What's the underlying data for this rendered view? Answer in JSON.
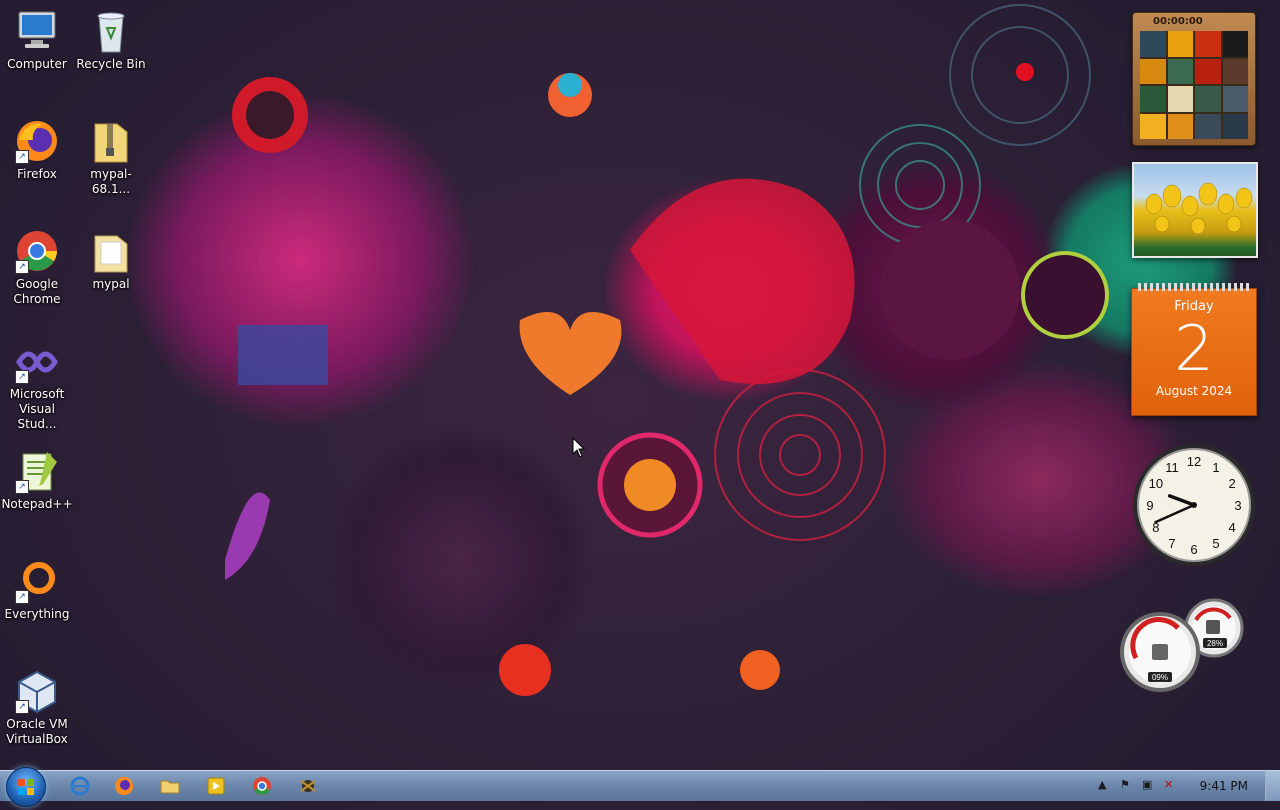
{
  "desktop": {
    "icons": [
      {
        "label": "Computer",
        "icon": "computer-icon"
      },
      {
        "label": "Recycle Bin",
        "icon": "recycle-bin-icon"
      },
      {
        "label": "Firefox",
        "icon": "firefox-icon"
      },
      {
        "label": "mypal-68.1...",
        "icon": "zip-folder-icon"
      },
      {
        "label": "Google Chrome",
        "icon": "chrome-icon"
      },
      {
        "label": "mypal",
        "icon": "folder-icon"
      },
      {
        "label": "Microsoft Visual Stud...",
        "icon": "visual-studio-icon"
      },
      {
        "label": "Notepad++",
        "icon": "notepadpp-icon"
      },
      {
        "label": "Everything",
        "icon": "everything-icon"
      },
      {
        "label": "Oracle VM VirtualBox",
        "icon": "virtualbox-icon"
      }
    ]
  },
  "gadgets": {
    "puzzle": {
      "timer": "00:00:00"
    },
    "calendar": {
      "day": "Friday",
      "date": "2",
      "month_year": "August 2024"
    },
    "clock": {
      "numbers": [
        "12",
        "1",
        "2",
        "3",
        "4",
        "5",
        "6",
        "7",
        "8",
        "9",
        "10",
        "11"
      ],
      "hour": 9,
      "minute": 41
    },
    "cpu_meter": {
      "cpu": "09%",
      "memory": "28%"
    }
  },
  "taskbar": {
    "pinned": [
      "internet-explorer-icon",
      "firefox-icon",
      "file-explorer-icon",
      "media-player-icon",
      "chrome-icon",
      "app-icon"
    ],
    "time": "9:41 PM"
  },
  "colors": {
    "taskbar": "#6b86aa",
    "calendar": "#e86c12",
    "accent_teal": "#1d9b7a",
    "accent_pink": "#e5256e"
  }
}
